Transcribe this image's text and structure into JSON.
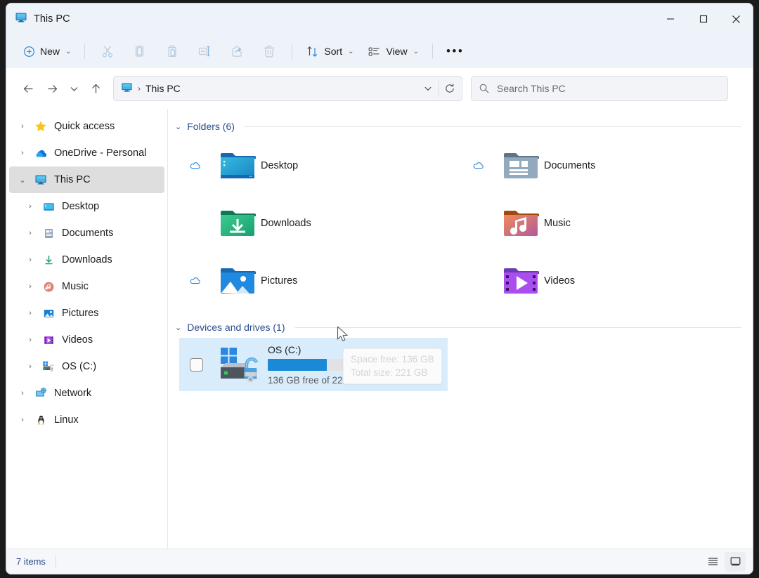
{
  "window": {
    "title": "This PC",
    "title_icon": "this-pc-monitor-icon",
    "controls": {
      "minimize": "─",
      "maximize": "☐",
      "close": "✕"
    }
  },
  "toolbar": {
    "new_label": "New",
    "sort_label": "Sort",
    "view_label": "View",
    "more_label": "•••",
    "icons": [
      {
        "name": "cut-icon",
        "tooltip": "Cut",
        "disabled": true
      },
      {
        "name": "copy-icon",
        "tooltip": "Copy",
        "disabled": true
      },
      {
        "name": "paste-icon",
        "tooltip": "Paste",
        "disabled": true
      },
      {
        "name": "rename-icon",
        "tooltip": "Rename",
        "disabled": true
      },
      {
        "name": "share-icon",
        "tooltip": "Share",
        "disabled": true
      },
      {
        "name": "delete-icon",
        "tooltip": "Delete",
        "disabled": true
      }
    ]
  },
  "addressbar": {
    "back": "back-arrow-icon",
    "forward": "forward-arrow-icon",
    "recent": "chevron-down-icon",
    "up": "up-arrow-icon",
    "breadcrumb": [
      "This PC"
    ],
    "breadcrumb_separator": "›",
    "dropdown": "chevron-down-icon",
    "refresh": "refresh-icon"
  },
  "search": {
    "placeholder": "Search This PC",
    "icon": "search-icon"
  },
  "sidebar": {
    "items": [
      {
        "label": "Quick access",
        "icon": "star-icon",
        "level": 0,
        "expander": "›",
        "selected": false
      },
      {
        "label": "OneDrive - Personal",
        "icon": "onedrive-cloud-icon",
        "level": 0,
        "expander": "›",
        "selected": false
      },
      {
        "label": "This PC",
        "icon": "this-pc-monitor-icon",
        "level": 0,
        "expander": "⌄",
        "selected": true
      },
      {
        "label": "Desktop",
        "icon": "desktop-folder-icon",
        "level": 1,
        "expander": "›",
        "selected": false
      },
      {
        "label": "Documents",
        "icon": "documents-folder-icon",
        "level": 1,
        "expander": "›",
        "selected": false
      },
      {
        "label": "Downloads",
        "icon": "downloads-folder-icon",
        "level": 1,
        "expander": "›",
        "selected": false
      },
      {
        "label": "Music",
        "icon": "music-folder-icon",
        "level": 1,
        "expander": "›",
        "selected": false
      },
      {
        "label": "Pictures",
        "icon": "pictures-folder-icon",
        "level": 1,
        "expander": "›",
        "selected": false
      },
      {
        "label": "Videos",
        "icon": "videos-folder-icon",
        "level": 1,
        "expander": "›",
        "selected": false
      },
      {
        "label": "OS (C:)",
        "icon": "drive-icon",
        "level": 1,
        "expander": "›",
        "selected": false
      },
      {
        "label": "Network",
        "icon": "network-icon",
        "level": 0,
        "expander": "›",
        "selected": false
      },
      {
        "label": "Linux",
        "icon": "linux-penguin-icon",
        "level": 0,
        "expander": "›",
        "selected": false
      }
    ]
  },
  "content": {
    "folders_group": {
      "label": "Folders (6)",
      "expander": "⌄",
      "items": [
        {
          "label": "Desktop",
          "icon": "desktop-folder-icon",
          "cloud": true
        },
        {
          "label": "Documents",
          "icon": "documents-folder-icon",
          "cloud": true
        },
        {
          "label": "Downloads",
          "icon": "downloads-folder-icon",
          "cloud": false
        },
        {
          "label": "Music",
          "icon": "music-folder-icon",
          "cloud": false
        },
        {
          "label": "Pictures",
          "icon": "pictures-folder-icon",
          "cloud": true
        },
        {
          "label": "Videos",
          "icon": "videos-folder-icon",
          "cloud": false
        }
      ]
    },
    "devices_group": {
      "label": "Devices and drives (1)",
      "expander": "⌄",
      "drive": {
        "name": "OS (C:)",
        "free_text": "136 GB free of 221 GB",
        "used_percent": 38,
        "selected": true,
        "checkbox_checked": false,
        "icon": "windows-drive-bitlocker-unlocked-icon"
      }
    },
    "tooltip": {
      "line1": "Space free: 136 GB",
      "line2": "Total size: 221 GB"
    }
  },
  "statusbar": {
    "item_count": "7 items",
    "views": [
      {
        "name": "details-view-button",
        "active": false
      },
      {
        "name": "large-icons-view-button",
        "active": true
      }
    ]
  },
  "colors": {
    "accent": "#1b8ad6",
    "selection": "#d9ecfb",
    "group_header": "#2b4c8c",
    "chrome": "#eef2f9"
  }
}
